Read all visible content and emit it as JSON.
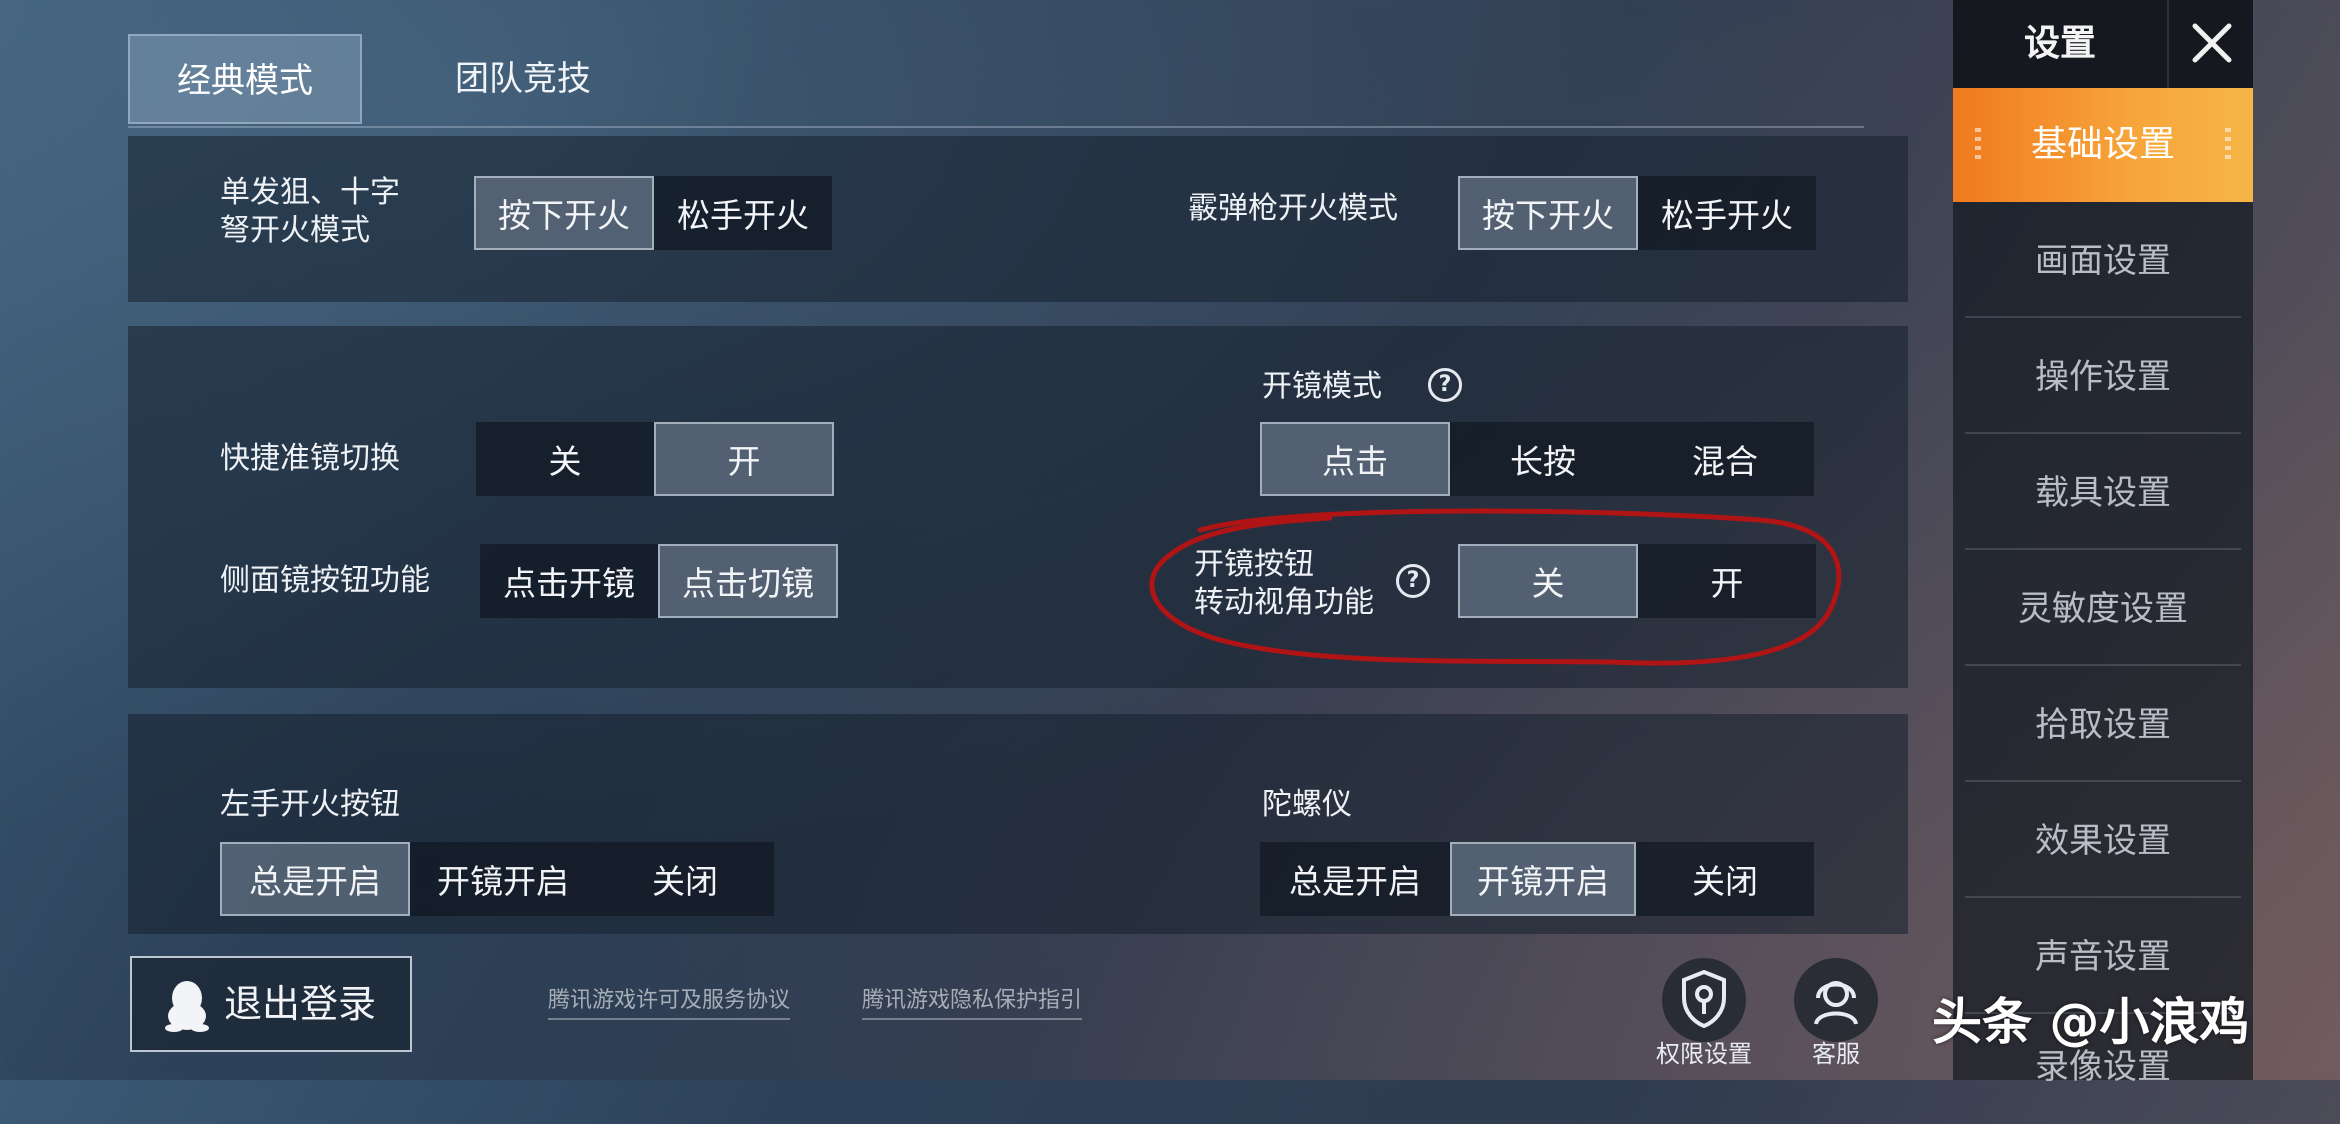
{
  "tabs": {
    "classic": "经典模式",
    "team": "团队竞技"
  },
  "section1": {
    "single_shot_label": "单发狙、十字\n弩开火模式",
    "single_shot_options": [
      "按下开火",
      "松手开火"
    ],
    "shotgun_label": "霰弹枪开火模式",
    "shotgun_options": [
      "按下开火",
      "松手开火"
    ]
  },
  "section2": {
    "quick_scope_label": "快捷准镜切换",
    "quick_scope_options": [
      "关",
      "开"
    ],
    "side_scope_label": "侧面镜按钮功能",
    "side_scope_options": [
      "点击开镜",
      "点击切镜"
    ],
    "scope_mode_label": "开镜模式",
    "scope_mode_options": [
      "点击",
      "长按",
      "混合"
    ],
    "scope_rotate_label": "开镜按钮\n转动视角功能",
    "scope_rotate_options": [
      "关",
      "开"
    ]
  },
  "section3": {
    "left_fire_label": "左手开火按钮",
    "left_fire_options": [
      "总是开启",
      "开镜开启",
      "关闭"
    ],
    "gyro_label": "陀螺仪",
    "gyro_options": [
      "总是开启",
      "开镜开启",
      "关闭"
    ]
  },
  "sidebar": {
    "title": "设置",
    "active": "基础设置",
    "items": [
      "画面设置",
      "操作设置",
      "载具设置",
      "灵敏度设置",
      "拾取设置",
      "效果设置",
      "声音设置",
      "录像设置"
    ]
  },
  "bottom": {
    "logout": "退出登录",
    "license_link": "腾讯游戏许可及服务协议",
    "privacy_link": "腾讯游戏隐私保护指引",
    "permissions": "权限设置",
    "support": "客服"
  },
  "watermark": "头条 @小浪鸡",
  "colors": {
    "accent": "#f39a2e",
    "annotation": "#b01414"
  }
}
